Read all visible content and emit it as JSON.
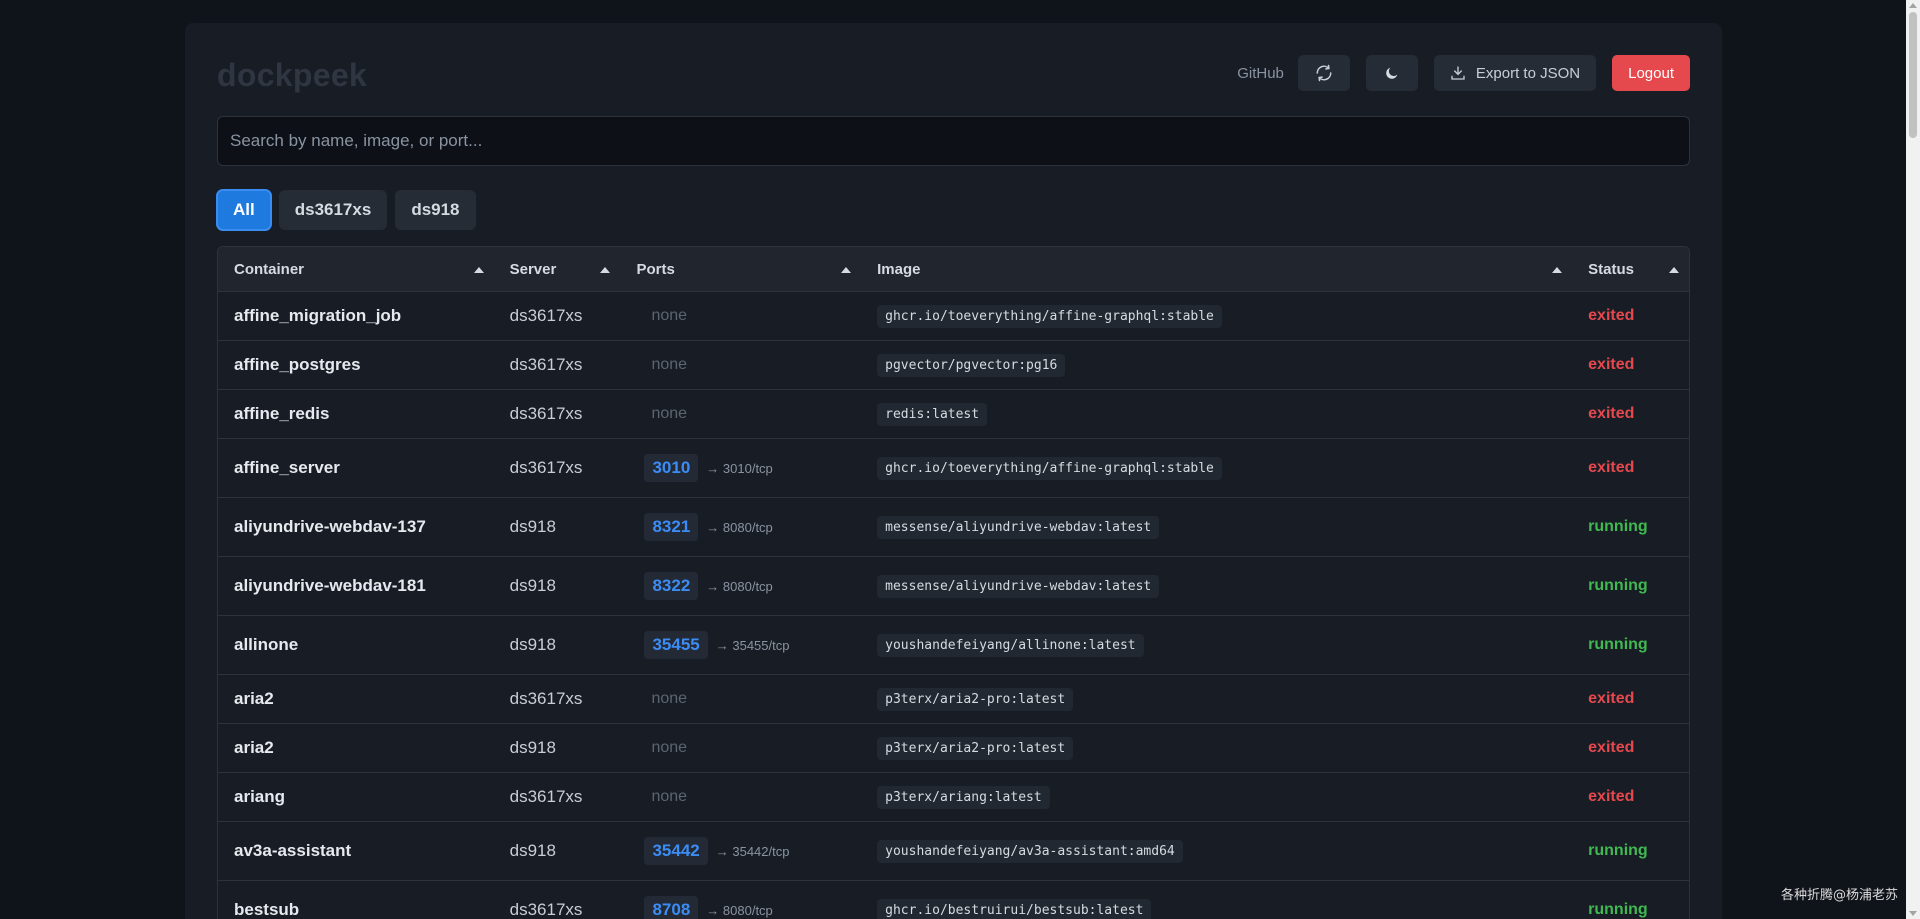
{
  "app": {
    "logo": "dockpeek"
  },
  "header": {
    "github_label": "GitHub",
    "refresh_icon": "refresh-icon",
    "theme_icon": "moon-icon",
    "export_label": "Export to JSON",
    "export_icon": "download-icon",
    "logout_label": "Logout"
  },
  "search": {
    "placeholder": "Search by name, image, or port..."
  },
  "filters": [
    "All",
    "ds3617xs",
    "ds918"
  ],
  "table": {
    "columns": [
      "Container",
      "Server",
      "Ports",
      "Image",
      "Status"
    ],
    "rows": [
      {
        "name": "affine_migration_job",
        "server": "ds3617xs",
        "port": null,
        "map": null,
        "image": "ghcr.io/toeverything/affine-graphql:stable",
        "status": "exited"
      },
      {
        "name": "affine_postgres",
        "server": "ds3617xs",
        "port": null,
        "map": null,
        "image": "pgvector/pgvector:pg16",
        "status": "exited"
      },
      {
        "name": "affine_redis",
        "server": "ds3617xs",
        "port": null,
        "map": null,
        "image": "redis:latest",
        "status": "exited"
      },
      {
        "name": "affine_server",
        "server": "ds3617xs",
        "port": "3010",
        "map": "→ 3010/tcp",
        "image": "ghcr.io/toeverything/affine-graphql:stable",
        "status": "exited"
      },
      {
        "name": "aliyundrive-webdav-137",
        "server": "ds918",
        "port": "8321",
        "map": "→ 8080/tcp",
        "image": "messense/aliyundrive-webdav:latest",
        "status": "running"
      },
      {
        "name": "aliyundrive-webdav-181",
        "server": "ds918",
        "port": "8322",
        "map": "→ 8080/tcp",
        "image": "messense/aliyundrive-webdav:latest",
        "status": "running"
      },
      {
        "name": "allinone",
        "server": "ds918",
        "port": "35455",
        "map": "→ 35455/tcp",
        "image": "youshandefeiyang/allinone:latest",
        "status": "running"
      },
      {
        "name": "aria2",
        "server": "ds3617xs",
        "port": null,
        "map": null,
        "image": "p3terx/aria2-pro:latest",
        "status": "exited"
      },
      {
        "name": "aria2",
        "server": "ds918",
        "port": null,
        "map": null,
        "image": "p3terx/aria2-pro:latest",
        "status": "exited"
      },
      {
        "name": "ariang",
        "server": "ds3617xs",
        "port": null,
        "map": null,
        "image": "p3terx/ariang:latest",
        "status": "exited"
      },
      {
        "name": "av3a-assistant",
        "server": "ds918",
        "port": "35442",
        "map": "→ 35442/tcp",
        "image": "youshandefeiyang/av3a-assistant:amd64",
        "status": "running"
      },
      {
        "name": "bestsub",
        "server": "ds3617xs",
        "port": "8708",
        "map": "→ 8080/tcp",
        "image": "ghcr.io/bestruirui/bestsub:latest",
        "status": "running"
      }
    ],
    "none_label": "none"
  },
  "watermark": "各种折腾@杨浦老苏",
  "colors": {
    "accent": "#1f7ae0",
    "exited": "#e5484d",
    "running": "#3fb950",
    "logout": "#e5484d"
  }
}
